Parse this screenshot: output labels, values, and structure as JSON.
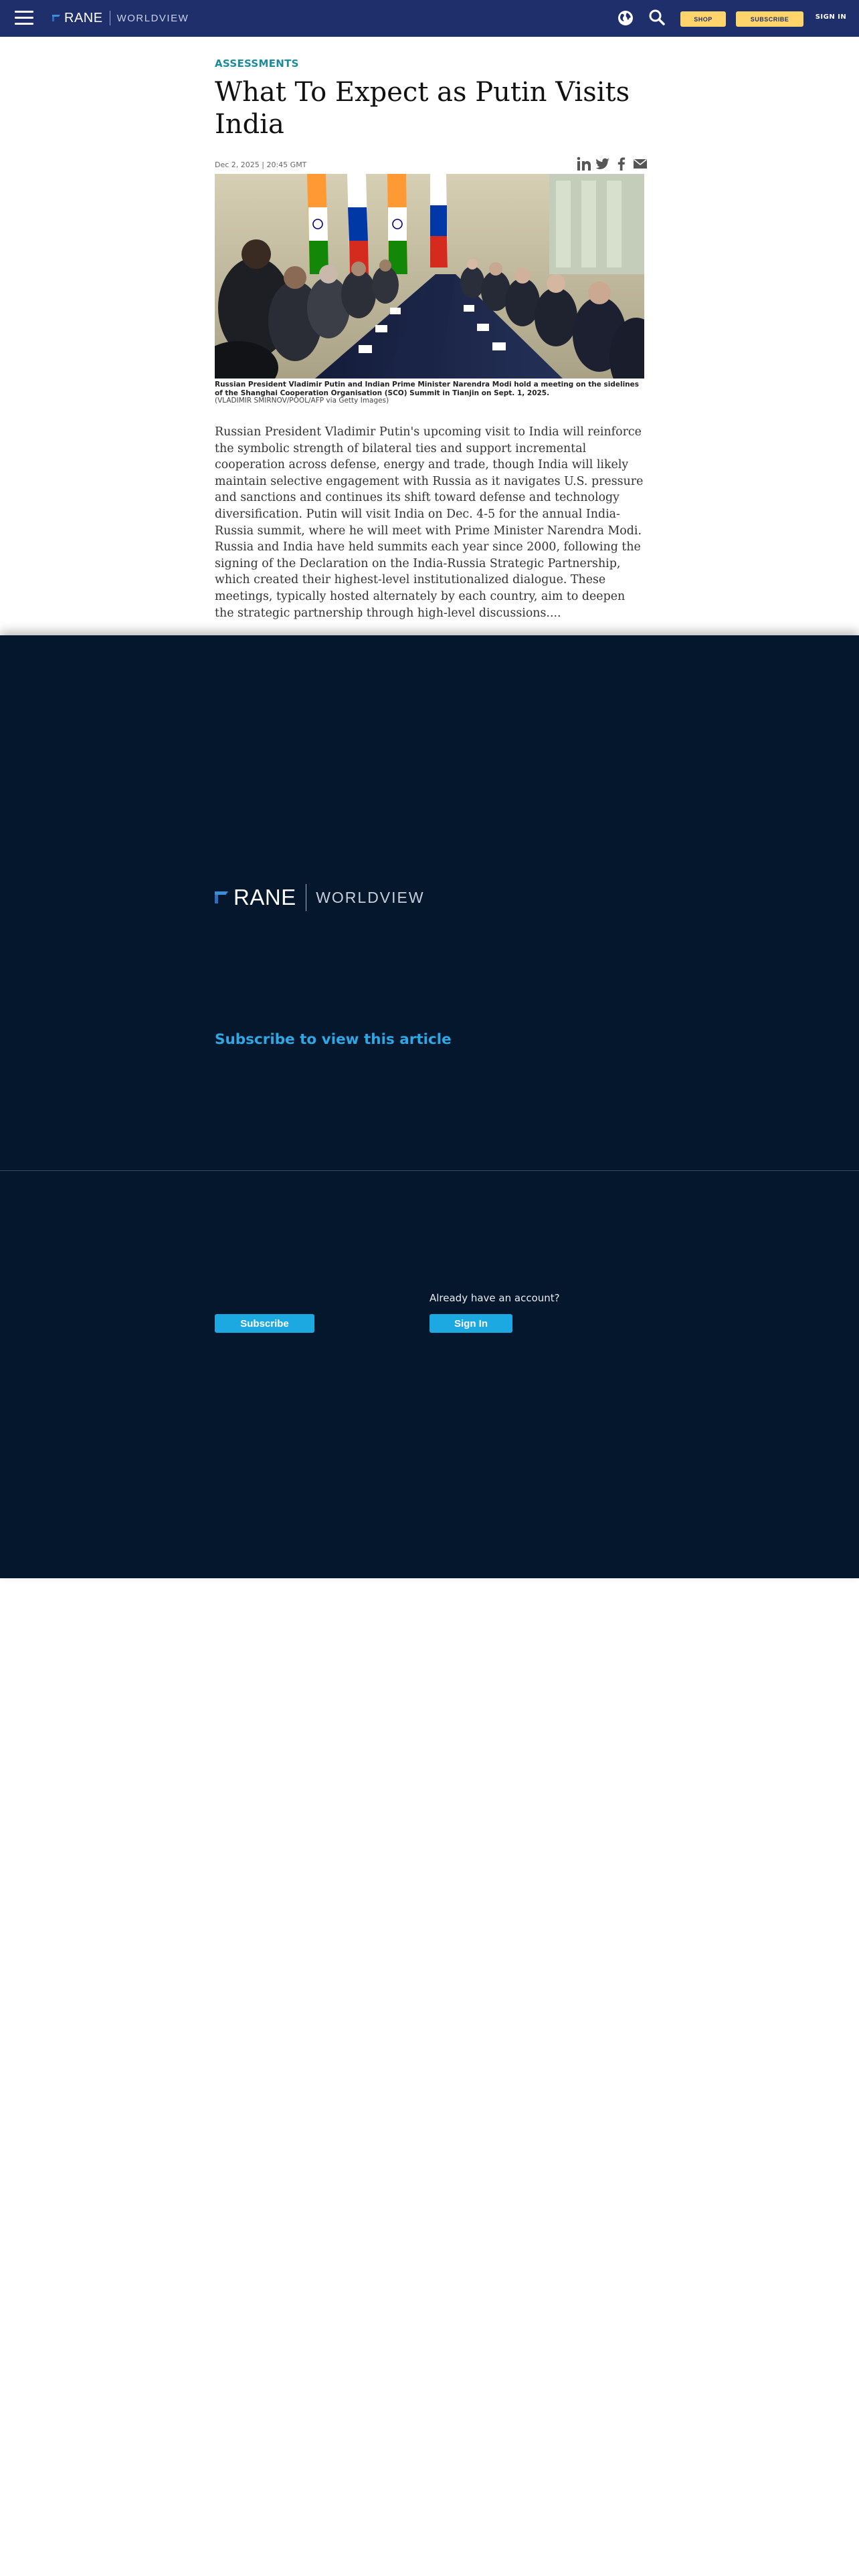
{
  "header": {
    "brand": "RANE",
    "product": "WORLDVIEW",
    "icons": [
      "menu-icon",
      "globe-icon",
      "search-icon"
    ],
    "shop_label": "SHOP",
    "subscribe_label": "SUBSCRIBE",
    "signin_label": "SIGN IN",
    "colors": {
      "bar": "#1f2f6b",
      "buttons": "#ffd46a"
    }
  },
  "article": {
    "category": "ASSESSMENTS",
    "title": "What To Expect as Putin Visits India",
    "date": "Dec 2, 2025 | 20:45 GMT",
    "share_icons": [
      "linkedin-icon",
      "twitter-icon",
      "facebook-icon",
      "email-icon"
    ],
    "caption": "Russian President Vladimir Putin and Indian Prime Minister Narendra Modi hold a meeting on the sidelines of the Shanghai Cooperation Organisation (SCO) Summit in Tianjin on Sept. 1, 2025.",
    "credit": "(VLADIMIR SMIRNOV/POOL/AFP via Getty Images)",
    "body": "Russian President Vladimir Putin's upcoming visit to India will reinforce the symbolic strength of bilateral ties and support incremental cooperation across defense, energy and trade, though India will likely maintain selective engagement with Russia as it navigates U.S. pressure and sanctions and continues its shift toward defense and technology diversification. Putin will visit India on Dec. 4-5 for the annual India-Russia summit, where he will meet with Prime Minister Narendra Modi. Russia and India have held summits each year since 2000, following the signing of the Declaration on the India-Russia Strategic Partnership, which created their highest-level institutionalized dialogue. These meetings, typically hosted alternately by each country, aim to deepen the strategic partnership through high-level discussions...."
  },
  "paywall": {
    "brand": "RANE",
    "product": "WORLDVIEW",
    "heading": "Subscribe to view this article",
    "subscribe_label": "Subscribe",
    "already_text": "Already have an account?",
    "signin_label": "Sign In",
    "colors": {
      "background": "#04172c",
      "accent": "#1ca8e0",
      "heading": "#2fa7e4"
    }
  }
}
